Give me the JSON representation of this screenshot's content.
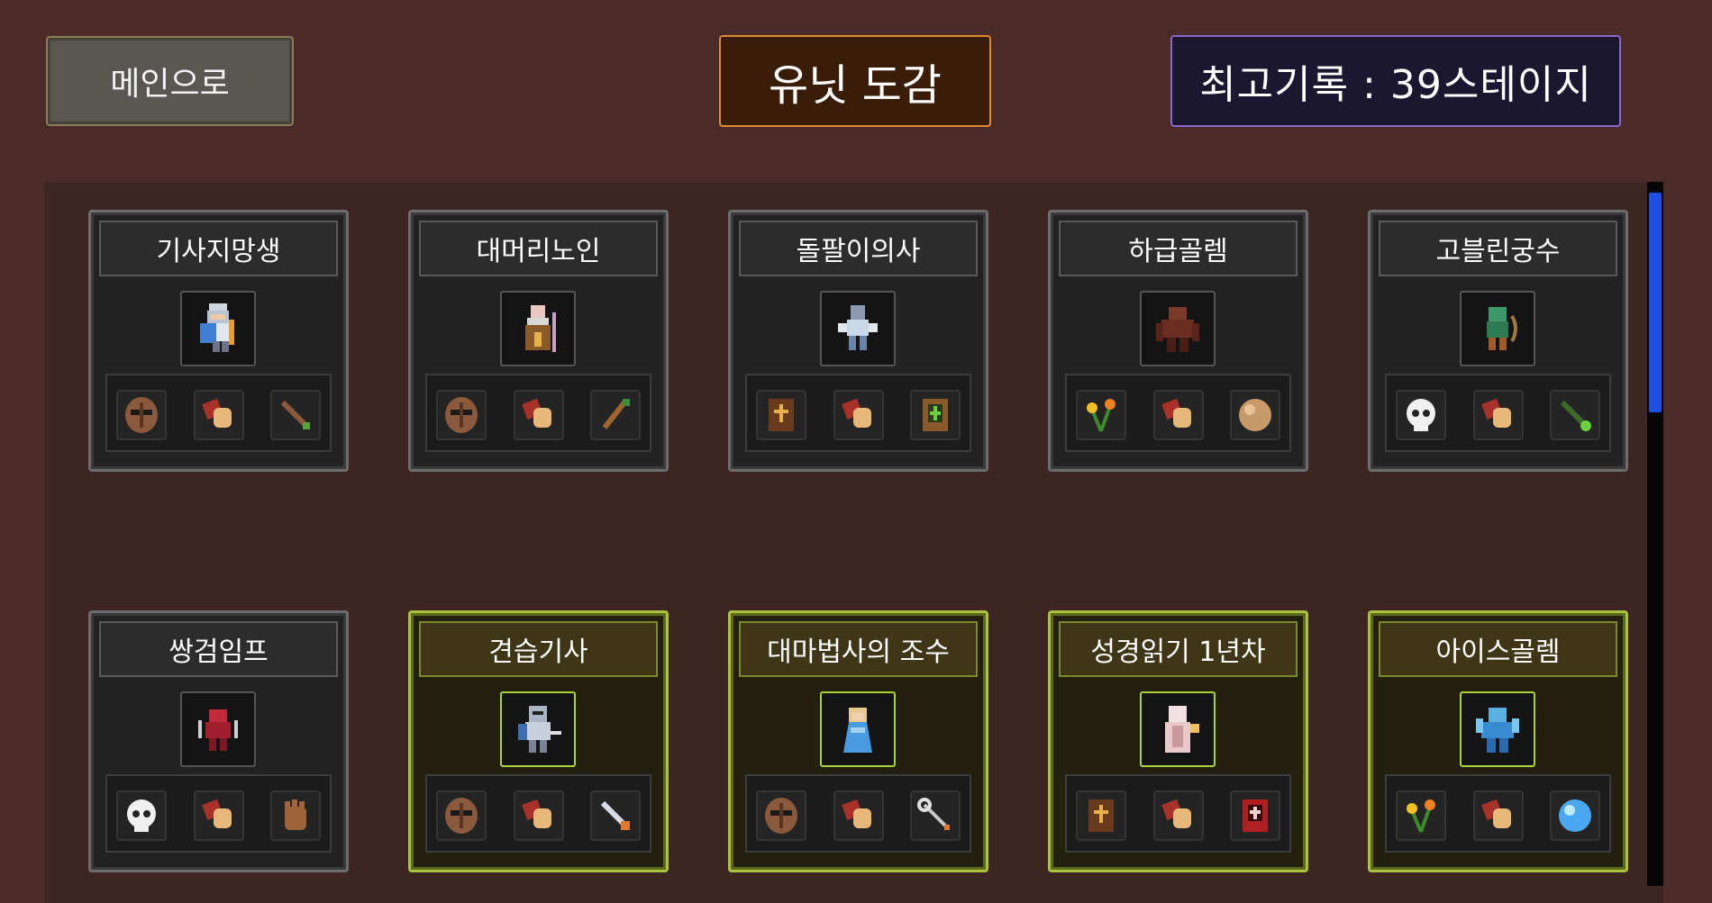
{
  "header": {
    "main_button_label": "메인으로",
    "title": "유닛 도감",
    "best_record": "최고기록 : 39스테이지"
  },
  "units": [
    {
      "name": "기사지망생",
      "portrait": "knight-trainee-sprite",
      "items": [
        "mask-icon",
        "bandage-icon",
        "sword-icon"
      ],
      "tier": "normal"
    },
    {
      "name": "대머리노인",
      "portrait": "bald-elder-sprite",
      "items": [
        "mask-icon",
        "bandage-icon",
        "staff-icon"
      ],
      "tier": "normal"
    },
    {
      "name": "돌팔이의사",
      "portrait": "quack-doctor-sprite",
      "items": [
        "holy-book-icon",
        "bandage-icon",
        "green-book-icon"
      ],
      "tier": "normal"
    },
    {
      "name": "하급골렘",
      "portrait": "lesser-golem-sprite",
      "items": [
        "flower-icon",
        "bandage-icon",
        "stone-icon"
      ],
      "tier": "normal"
    },
    {
      "name": "고블린궁수",
      "portrait": "goblin-archer-sprite",
      "items": [
        "skull-icon",
        "bandage-icon",
        "wand-icon"
      ],
      "tier": "normal"
    },
    {
      "name": "쌍검임프",
      "portrait": "dual-blade-imp-sprite",
      "items": [
        "skull-icon",
        "bandage-icon",
        "glove-icon"
      ],
      "tier": "normal"
    },
    {
      "name": "견습기사",
      "portrait": "apprentice-knight-sprite",
      "items": [
        "mask-icon",
        "bandage-icon",
        "sword-icon"
      ],
      "tier": "rare"
    },
    {
      "name": "대마법사의 조수",
      "portrait": "archmage-assistant-sprite",
      "items": [
        "mask-icon",
        "bandage-icon",
        "scepter-icon"
      ],
      "tier": "rare"
    },
    {
      "name": "성경읽기 1년차",
      "portrait": "bible-reader-sprite",
      "items": [
        "holy-book-icon",
        "bandage-icon",
        "red-book-icon"
      ],
      "tier": "rare"
    },
    {
      "name": "아이스골렘",
      "portrait": "ice-golem-sprite",
      "items": [
        "flower-icon",
        "bandage-icon",
        "ice-orb-icon"
      ],
      "tier": "rare"
    }
  ],
  "colors": {
    "background": "#4a2b27",
    "panel": "#3d2521",
    "normal_border": "#6d6d6d",
    "rare_border": "#a9c23f",
    "scrollbar": "#1f4fe0"
  }
}
